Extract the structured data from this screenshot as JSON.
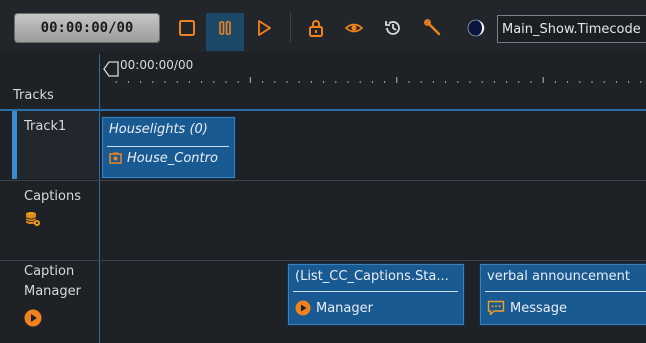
{
  "toolbar": {
    "timecode": "00:00:00/00",
    "timecode_field": "Main_Show.Timecode"
  },
  "ruler": {
    "start_label": "00:00:00/00"
  },
  "tracks_label": "Tracks",
  "tracks": [
    {
      "name": "Track1",
      "clips": [
        {
          "title": "Houselights (0)",
          "subtitle": "House_Contro",
          "icon": "fixture-icon"
        }
      ]
    },
    {
      "name": "Captions",
      "icon": "database-icon",
      "clips": []
    },
    {
      "name": "Caption Manager",
      "name_line1": "Caption",
      "name_line2": "Manager",
      "icon": "play-circle-icon",
      "clips": [
        {
          "title": "(List_CC_Captions.Sta...",
          "subtitle": "Manager",
          "icon": "play-circle-icon"
        },
        {
          "title": "verbal announcement",
          "subtitle": "Message",
          "icon": "message-icon"
        }
      ]
    }
  ],
  "colors": {
    "accent": "#1a5a92",
    "orange": "#f0821e",
    "background": "#1e2226"
  }
}
